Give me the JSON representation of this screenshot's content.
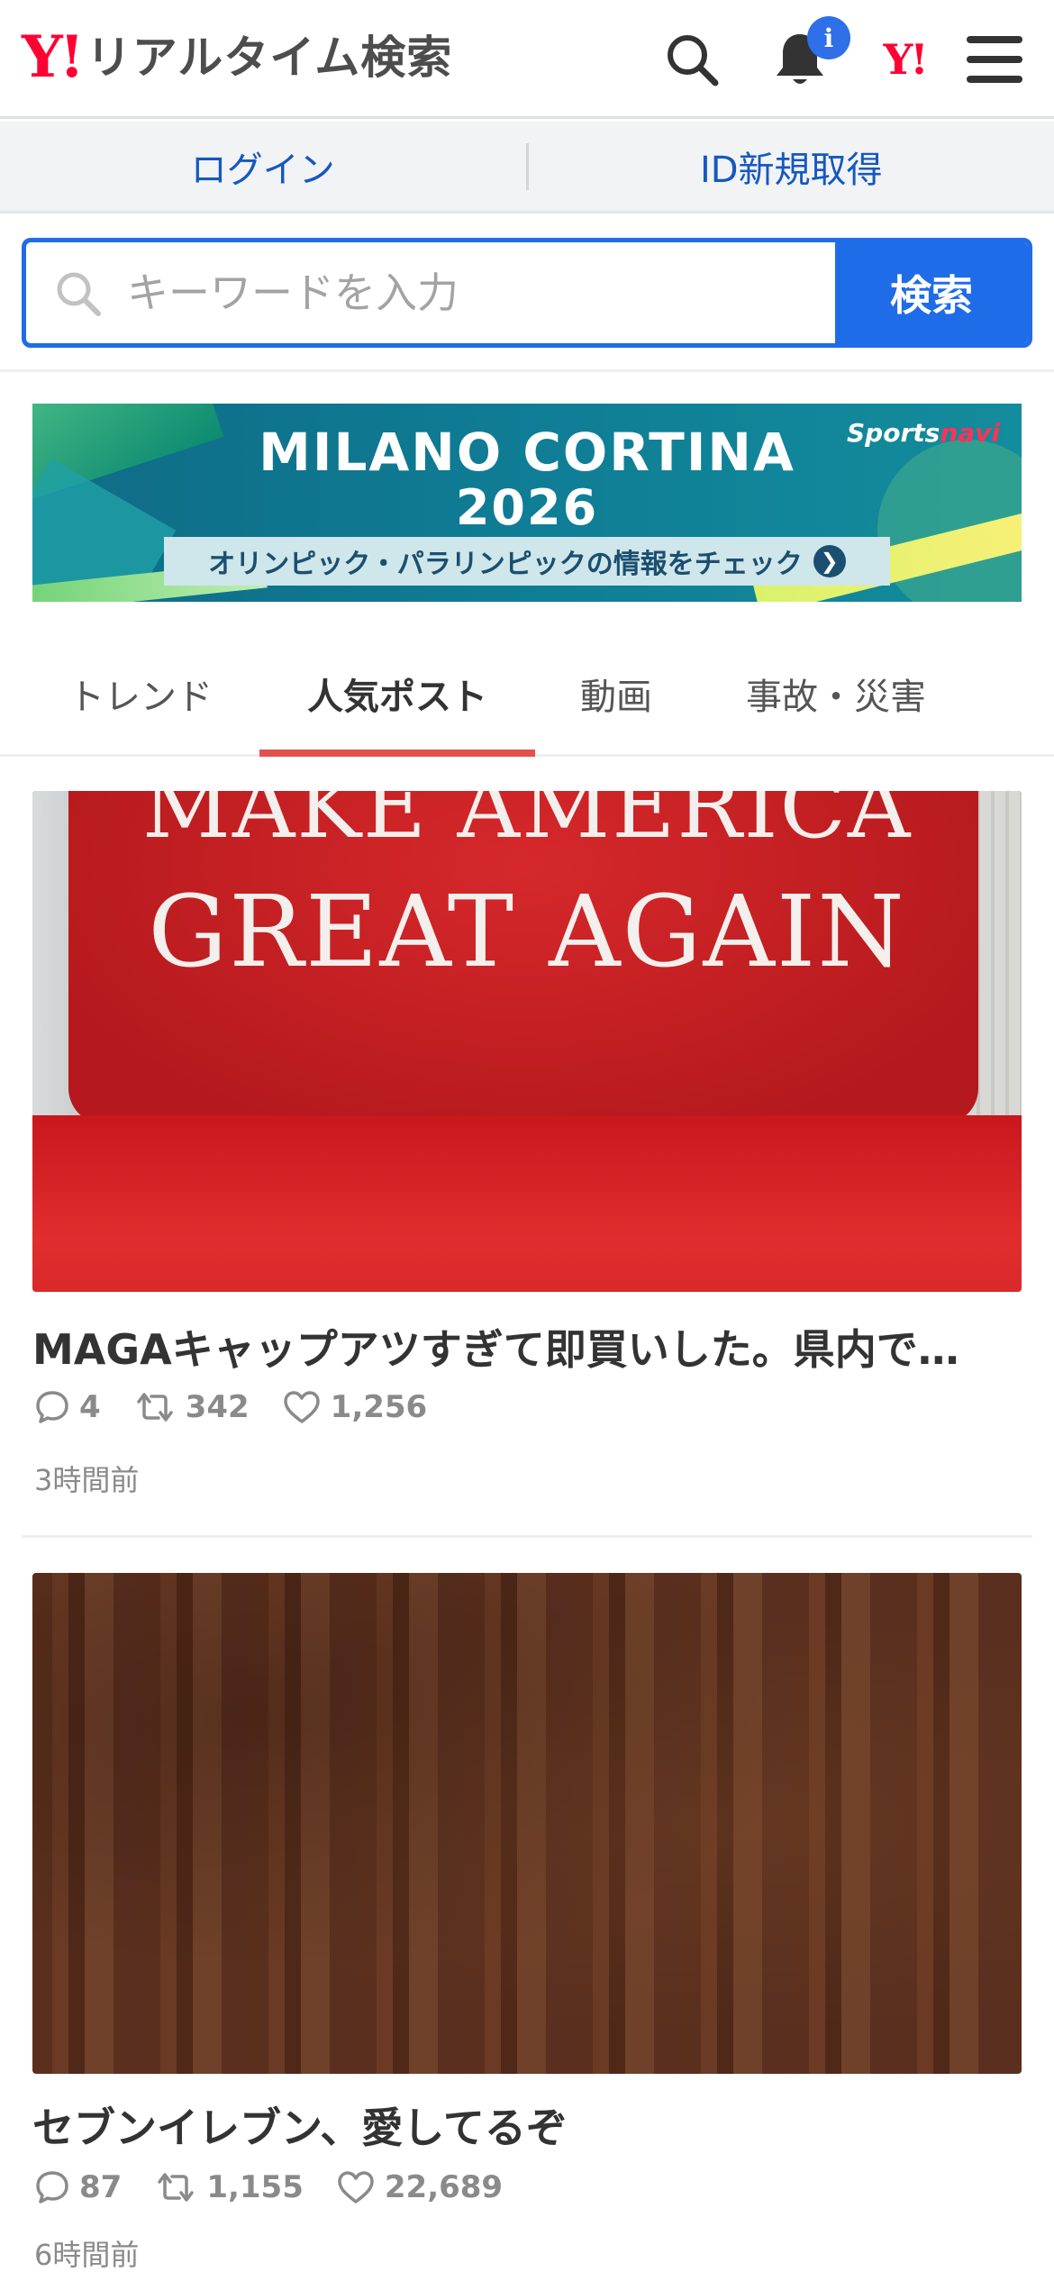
{
  "header": {
    "logo_mark": "Y!",
    "logo_text": "リアルタイム検索",
    "notification_badge": "i",
    "yahoo_small": "Y!",
    "icons": [
      "search-icon",
      "bell-icon",
      "yahoo-logo",
      "menu-icon"
    ]
  },
  "loginbar": {
    "login": "ログイン",
    "signup": "ID新規取得"
  },
  "search": {
    "placeholder": "キーワードを入力",
    "button": "検索"
  },
  "banner": {
    "line1": "MILANO CORTINA",
    "line2": "2026",
    "strip": "オリンピック・パラリンピックの情報をチェック",
    "brand_a": "Sports",
    "brand_b": "navi"
  },
  "tabs": [
    {
      "label": "トレンド",
      "active": false
    },
    {
      "label": "人気ポスト",
      "active": true
    },
    {
      "label": "動画",
      "active": false
    },
    {
      "label": "事故・災害",
      "active": false
    }
  ],
  "posts": [
    {
      "image_text_1": "MAKE AMERICA",
      "image_text_2": "GREAT AGAIN",
      "title": "MAGAキャップアツすぎて即買いした。県内で…",
      "replies": "4",
      "reposts": "342",
      "likes": "1,256",
      "time": "3時間前"
    },
    {
      "title": "セブンイレブン、愛してるぞ",
      "replies": "87",
      "reposts": "1,155",
      "likes": "22,689",
      "time": "6時間前"
    }
  ],
  "colors": {
    "brand_red": "#ff0033",
    "accent_blue": "#1f6ce8",
    "tab_underline": "#e4504c"
  }
}
